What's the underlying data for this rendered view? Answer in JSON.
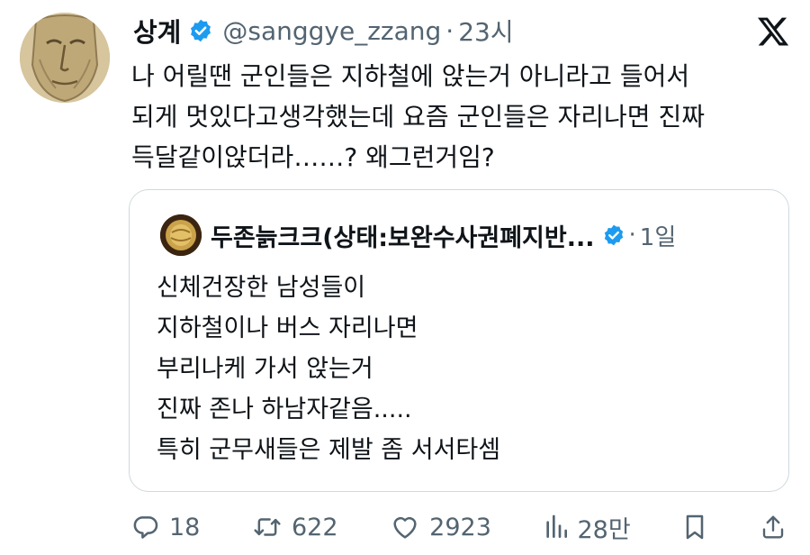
{
  "tweet": {
    "author_name": "상계",
    "handle": "@sanggye_zzang",
    "separator": "·",
    "time": "23시",
    "lines": [
      "나 어릴땐 군인들은 지하철에 앉는거 아니라고 들어서",
      "되게 멋있다고생각했는데 요즘 군인들은 자리나면 진짜",
      "득달같이앉더라……? 왜그런거임?"
    ]
  },
  "quote": {
    "author_name": "두존늙크크(상태:보완수사권폐지반...",
    "separator": "·",
    "time": "1일",
    "lines": [
      "신체건장한 남성들이",
      "지하철이나 버스 자리나면",
      "부리나케 가서 앉는거",
      "진짜 존나 하남자같음.....",
      "특히 군무새들은 제발 좀 서서타셈"
    ]
  },
  "actions": {
    "replies": "18",
    "retweets": "622",
    "likes": "2923",
    "views": "28만"
  },
  "icons": {
    "verified": "verified-badge-icon",
    "platform": "x-logo-icon",
    "reply": "reply-icon",
    "retweet": "retweet-icon",
    "like": "heart-icon",
    "views": "views-icon",
    "bookmark": "bookmark-icon",
    "share": "share-icon"
  },
  "colors": {
    "verified": "#1d9bf0",
    "text": "#0f1419",
    "secondary": "#536471",
    "border": "#cfd9de"
  }
}
